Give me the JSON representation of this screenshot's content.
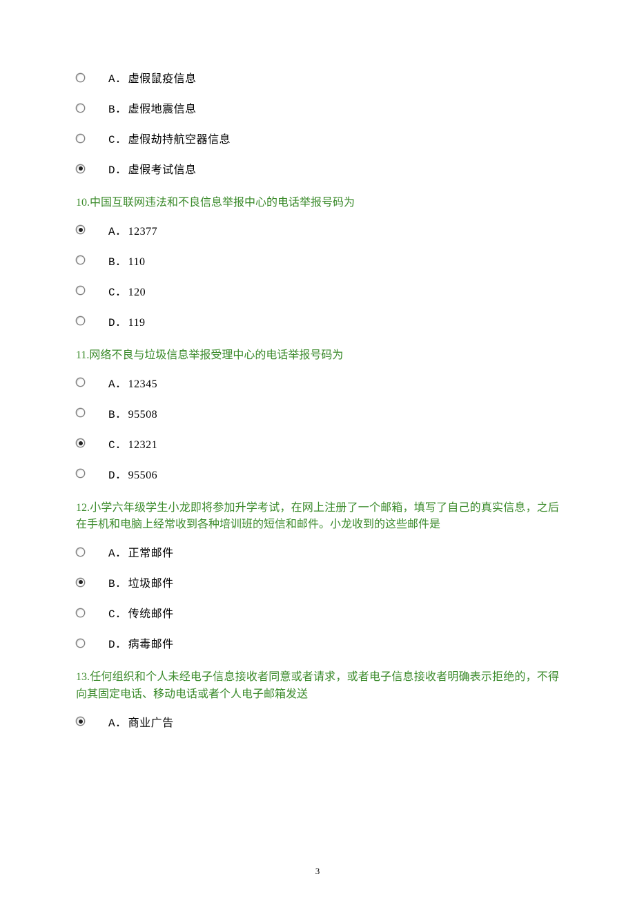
{
  "q9": {
    "options": [
      {
        "prefix": "A．",
        "text": "虚假鼠疫信息",
        "selected": false
      },
      {
        "prefix": "B．",
        "text": "虚假地震信息",
        "selected": false
      },
      {
        "prefix": "C．",
        "text": "虚假劫持航空器信息",
        "selected": false
      },
      {
        "prefix": "D．",
        "text": "虚假考试信息",
        "selected": true
      }
    ]
  },
  "q10": {
    "title": "10.中国互联网违法和不良信息举报中心的电话举报号码为",
    "options": [
      {
        "prefix": "A．",
        "text": "12377",
        "selected": true
      },
      {
        "prefix": "B．",
        "text": "110",
        "selected": false
      },
      {
        "prefix": "C．",
        "text": "120",
        "selected": false
      },
      {
        "prefix": "D．",
        "text": "119",
        "selected": false
      }
    ]
  },
  "q11": {
    "title": "11.网络不良与垃圾信息举报受理中心的电话举报号码为",
    "options": [
      {
        "prefix": "A．",
        "text": "12345",
        "selected": false
      },
      {
        "prefix": "B．",
        "text": "95508",
        "selected": false
      },
      {
        "prefix": "C．",
        "text": "12321",
        "selected": true
      },
      {
        "prefix": "D．",
        "text": "95506",
        "selected": false
      }
    ]
  },
  "q12": {
    "title": "12.小学六年级学生小龙即将参加升学考试，在网上注册了一个邮箱，填写了自己的真实信息，之后在手机和电脑上经常收到各种培训班的短信和邮件。小龙收到的这些邮件是",
    "options": [
      {
        "prefix": "A．",
        "text": "正常邮件",
        "selected": false
      },
      {
        "prefix": "B．",
        "text": "垃圾邮件",
        "selected": true
      },
      {
        "prefix": "C．",
        "text": "传统邮件",
        "selected": false
      },
      {
        "prefix": "D．",
        "text": "病毒邮件",
        "selected": false
      }
    ]
  },
  "q13": {
    "title": "13.任何组织和个人未经电子信息接收者同意或者请求，或者电子信息接收者明确表示拒绝的，不得向其固定电话、移动电话或者个人电子邮箱发送",
    "options": [
      {
        "prefix": "A．",
        "text": "商业广告",
        "selected": true
      }
    ]
  },
  "pageNumber": "3"
}
